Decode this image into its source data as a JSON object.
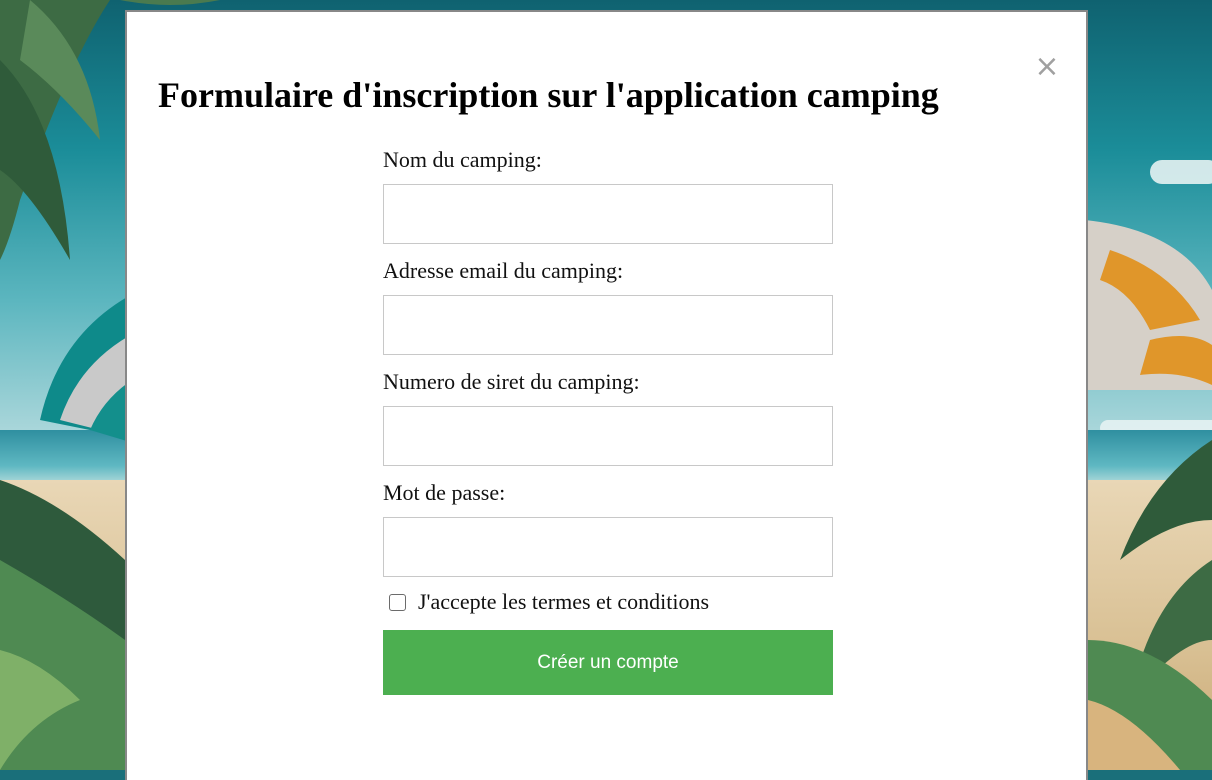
{
  "modal": {
    "title": "Formulaire d'inscription sur l'application camping",
    "close_symbol": "×",
    "close_icon": "close-icon"
  },
  "form": {
    "fields": [
      {
        "label": "Nom du camping:",
        "value": "",
        "placeholder": ""
      },
      {
        "label": "Adresse email du camping:",
        "value": "",
        "placeholder": ""
      },
      {
        "label": "Numero de siret du camping:",
        "value": "",
        "placeholder": ""
      },
      {
        "label": "Mot de passe:",
        "value": "",
        "placeholder": ""
      }
    ],
    "terms": {
      "label": "J'accepte les termes et conditions",
      "checked": false
    },
    "submit_label": "Créer un compte"
  },
  "colors": {
    "submit_button": "#4caf50",
    "modal_background": "#ffffff",
    "close_icon": "#a0a0a0"
  }
}
